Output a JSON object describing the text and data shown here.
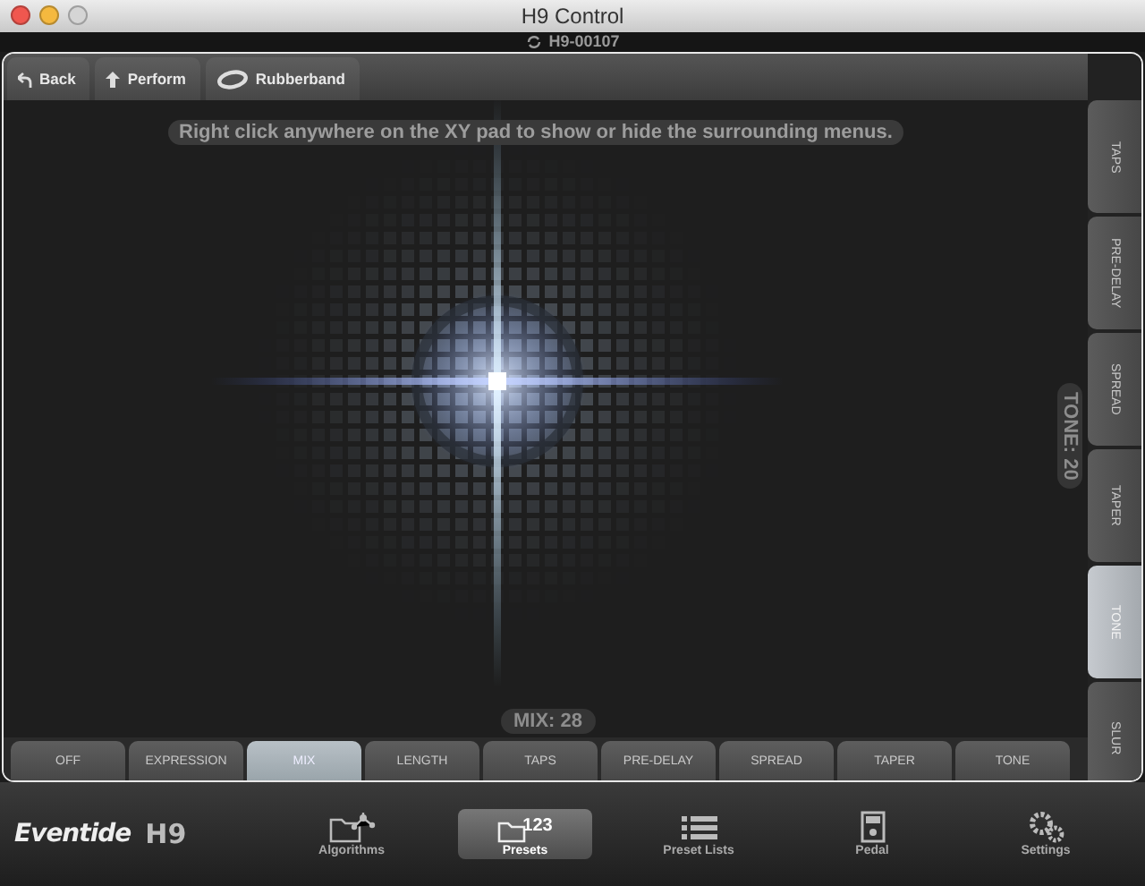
{
  "window": {
    "title": "H9 Control"
  },
  "device": {
    "name": "H9-00107"
  },
  "toolbar": [
    {
      "kind": "back",
      "label": "Back"
    },
    {
      "kind": "perform",
      "label": "Perform"
    },
    {
      "kind": "rubberband",
      "label": "Rubberband"
    }
  ],
  "hint": "Right click anywhere on the XY pad to show or hide the surrounding menus.",
  "y_readout": "TONE: 20",
  "x_readout": "MIX: 28",
  "y_params": [
    {
      "label": "TAPS",
      "selected": false
    },
    {
      "label": "PRE-DELAY",
      "selected": false
    },
    {
      "label": "SPREAD",
      "selected": false
    },
    {
      "label": "TAPER",
      "selected": false
    },
    {
      "label": "TONE",
      "selected": true
    },
    {
      "label": "SLUR",
      "selected": false
    }
  ],
  "x_params": [
    {
      "label": "OFF",
      "selected": false
    },
    {
      "label": "EXPRESSION",
      "selected": false
    },
    {
      "label": "MIX",
      "selected": true
    },
    {
      "label": "LENGTH",
      "selected": false
    },
    {
      "label": "TAPS",
      "selected": false
    },
    {
      "label": "PRE-DELAY",
      "selected": false
    },
    {
      "label": "SPREAD",
      "selected": false
    },
    {
      "label": "TAPER",
      "selected": false
    },
    {
      "label": "TONE",
      "selected": false
    }
  ],
  "brand": {
    "name": "Eventide",
    "model": "H9"
  },
  "nav": [
    {
      "kind": "algorithms",
      "label": "Algorithms",
      "selected": false
    },
    {
      "kind": "presets",
      "label": "Presets",
      "selected": true,
      "badge": "123"
    },
    {
      "kind": "lists",
      "label": "Preset Lists",
      "selected": false
    },
    {
      "kind": "pedal",
      "label": "Pedal",
      "selected": false
    },
    {
      "kind": "settings",
      "label": "Settings",
      "selected": false
    }
  ]
}
